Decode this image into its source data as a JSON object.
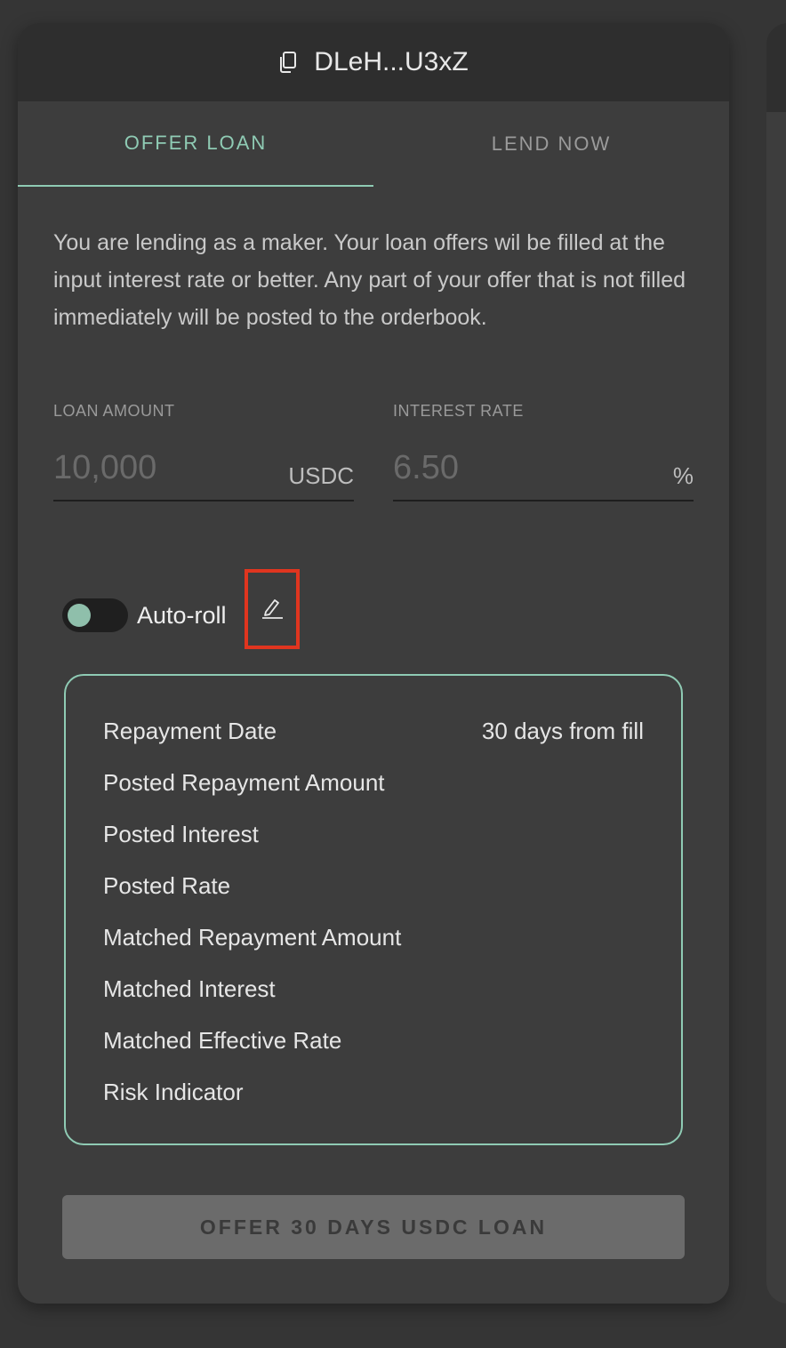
{
  "header": {
    "address": "DLeH...U3xZ",
    "icon": "copy-icon"
  },
  "tabs": [
    {
      "label": "OFFER LOAN",
      "active": true
    },
    {
      "label": "LEND NOW",
      "active": false
    }
  ],
  "description": "You are lending as a maker. Your loan offers wil be filled at the input interest rate or better. Any part of your offer that is not filled immediately will be posted to the orderbook.",
  "loan_amount": {
    "label": "LOAN AMOUNT",
    "placeholder": "10,000",
    "unit": "USDC"
  },
  "interest_rate": {
    "label": "INTEREST RATE",
    "placeholder": "6.50",
    "unit": "%"
  },
  "auto_roll": {
    "label": "Auto-roll",
    "enabled": false,
    "edit_icon": "pencil-icon"
  },
  "summary": {
    "rows": [
      {
        "label": "Repayment Date",
        "value": "30 days from fill"
      },
      {
        "label": "Posted Repayment Amount",
        "value": ""
      },
      {
        "label": "Posted Interest",
        "value": ""
      },
      {
        "label": "Posted Rate",
        "value": ""
      },
      {
        "label": "Matched Repayment Amount",
        "value": ""
      },
      {
        "label": "Matched Interest",
        "value": ""
      },
      {
        "label": "Matched Effective Rate",
        "value": ""
      },
      {
        "label": "Risk Indicator",
        "value": ""
      }
    ]
  },
  "submit_button": {
    "label": "OFFER 30 DAYS USDC LOAN"
  },
  "colors": {
    "accent": "#8fcbb4",
    "highlight": "#e0351f",
    "background": "#353535",
    "card": "#3d3d3d"
  }
}
